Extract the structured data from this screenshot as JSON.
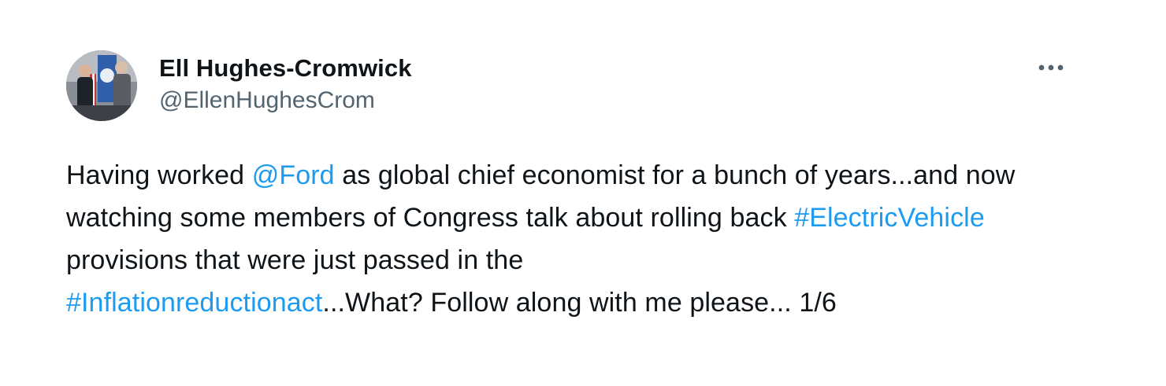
{
  "author": {
    "display_name": "Ell Hughes-Cromwick",
    "handle": "@EllenHughesCrom",
    "avatar_icon": "profile-photo"
  },
  "more_icon": "more-horizontal-icon",
  "colors": {
    "link": "#1d9bf0",
    "text": "#0f1419",
    "secondary": "#536471"
  },
  "tweet": {
    "text_1": "Having worked ",
    "mention": "@Ford",
    "text_2": " as global chief economist for a bunch of years...and now watching some members of Congress talk about rolling back ",
    "hashtag_1": "#ElectricVehicle",
    "text_3": " provisions that were just passed in the ",
    "hashtag_2": "#Inflationreductionact",
    "text_4": "...What? Follow along with me please... 1/6"
  }
}
